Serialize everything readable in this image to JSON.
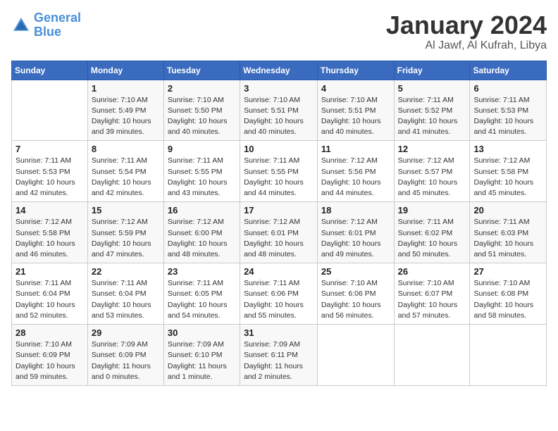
{
  "header": {
    "logo_line1": "General",
    "logo_line2": "Blue",
    "month": "January 2024",
    "location": "Al Jawf, Al Kufrah, Libya"
  },
  "days_of_week": [
    "Sunday",
    "Monday",
    "Tuesday",
    "Wednesday",
    "Thursday",
    "Friday",
    "Saturday"
  ],
  "weeks": [
    [
      {
        "num": "",
        "info": ""
      },
      {
        "num": "1",
        "info": "Sunrise: 7:10 AM\nSunset: 5:49 PM\nDaylight: 10 hours\nand 39 minutes."
      },
      {
        "num": "2",
        "info": "Sunrise: 7:10 AM\nSunset: 5:50 PM\nDaylight: 10 hours\nand 40 minutes."
      },
      {
        "num": "3",
        "info": "Sunrise: 7:10 AM\nSunset: 5:51 PM\nDaylight: 10 hours\nand 40 minutes."
      },
      {
        "num": "4",
        "info": "Sunrise: 7:10 AM\nSunset: 5:51 PM\nDaylight: 10 hours\nand 40 minutes."
      },
      {
        "num": "5",
        "info": "Sunrise: 7:11 AM\nSunset: 5:52 PM\nDaylight: 10 hours\nand 41 minutes."
      },
      {
        "num": "6",
        "info": "Sunrise: 7:11 AM\nSunset: 5:53 PM\nDaylight: 10 hours\nand 41 minutes."
      }
    ],
    [
      {
        "num": "7",
        "info": "Sunrise: 7:11 AM\nSunset: 5:53 PM\nDaylight: 10 hours\nand 42 minutes."
      },
      {
        "num": "8",
        "info": "Sunrise: 7:11 AM\nSunset: 5:54 PM\nDaylight: 10 hours\nand 42 minutes."
      },
      {
        "num": "9",
        "info": "Sunrise: 7:11 AM\nSunset: 5:55 PM\nDaylight: 10 hours\nand 43 minutes."
      },
      {
        "num": "10",
        "info": "Sunrise: 7:11 AM\nSunset: 5:55 PM\nDaylight: 10 hours\nand 44 minutes."
      },
      {
        "num": "11",
        "info": "Sunrise: 7:12 AM\nSunset: 5:56 PM\nDaylight: 10 hours\nand 44 minutes."
      },
      {
        "num": "12",
        "info": "Sunrise: 7:12 AM\nSunset: 5:57 PM\nDaylight: 10 hours\nand 45 minutes."
      },
      {
        "num": "13",
        "info": "Sunrise: 7:12 AM\nSunset: 5:58 PM\nDaylight: 10 hours\nand 45 minutes."
      }
    ],
    [
      {
        "num": "14",
        "info": "Sunrise: 7:12 AM\nSunset: 5:58 PM\nDaylight: 10 hours\nand 46 minutes."
      },
      {
        "num": "15",
        "info": "Sunrise: 7:12 AM\nSunset: 5:59 PM\nDaylight: 10 hours\nand 47 minutes."
      },
      {
        "num": "16",
        "info": "Sunrise: 7:12 AM\nSunset: 6:00 PM\nDaylight: 10 hours\nand 48 minutes."
      },
      {
        "num": "17",
        "info": "Sunrise: 7:12 AM\nSunset: 6:01 PM\nDaylight: 10 hours\nand 48 minutes."
      },
      {
        "num": "18",
        "info": "Sunrise: 7:12 AM\nSunset: 6:01 PM\nDaylight: 10 hours\nand 49 minutes."
      },
      {
        "num": "19",
        "info": "Sunrise: 7:11 AM\nSunset: 6:02 PM\nDaylight: 10 hours\nand 50 minutes."
      },
      {
        "num": "20",
        "info": "Sunrise: 7:11 AM\nSunset: 6:03 PM\nDaylight: 10 hours\nand 51 minutes."
      }
    ],
    [
      {
        "num": "21",
        "info": "Sunrise: 7:11 AM\nSunset: 6:04 PM\nDaylight: 10 hours\nand 52 minutes."
      },
      {
        "num": "22",
        "info": "Sunrise: 7:11 AM\nSunset: 6:04 PM\nDaylight: 10 hours\nand 53 minutes."
      },
      {
        "num": "23",
        "info": "Sunrise: 7:11 AM\nSunset: 6:05 PM\nDaylight: 10 hours\nand 54 minutes."
      },
      {
        "num": "24",
        "info": "Sunrise: 7:11 AM\nSunset: 6:06 PM\nDaylight: 10 hours\nand 55 minutes."
      },
      {
        "num": "25",
        "info": "Sunrise: 7:10 AM\nSunset: 6:06 PM\nDaylight: 10 hours\nand 56 minutes."
      },
      {
        "num": "26",
        "info": "Sunrise: 7:10 AM\nSunset: 6:07 PM\nDaylight: 10 hours\nand 57 minutes."
      },
      {
        "num": "27",
        "info": "Sunrise: 7:10 AM\nSunset: 6:08 PM\nDaylight: 10 hours\nand 58 minutes."
      }
    ],
    [
      {
        "num": "28",
        "info": "Sunrise: 7:10 AM\nSunset: 6:09 PM\nDaylight: 10 hours\nand 59 minutes."
      },
      {
        "num": "29",
        "info": "Sunrise: 7:09 AM\nSunset: 6:09 PM\nDaylight: 11 hours\nand 0 minutes."
      },
      {
        "num": "30",
        "info": "Sunrise: 7:09 AM\nSunset: 6:10 PM\nDaylight: 11 hours\nand 1 minute."
      },
      {
        "num": "31",
        "info": "Sunrise: 7:09 AM\nSunset: 6:11 PM\nDaylight: 11 hours\nand 2 minutes."
      },
      {
        "num": "",
        "info": ""
      },
      {
        "num": "",
        "info": ""
      },
      {
        "num": "",
        "info": ""
      }
    ]
  ]
}
